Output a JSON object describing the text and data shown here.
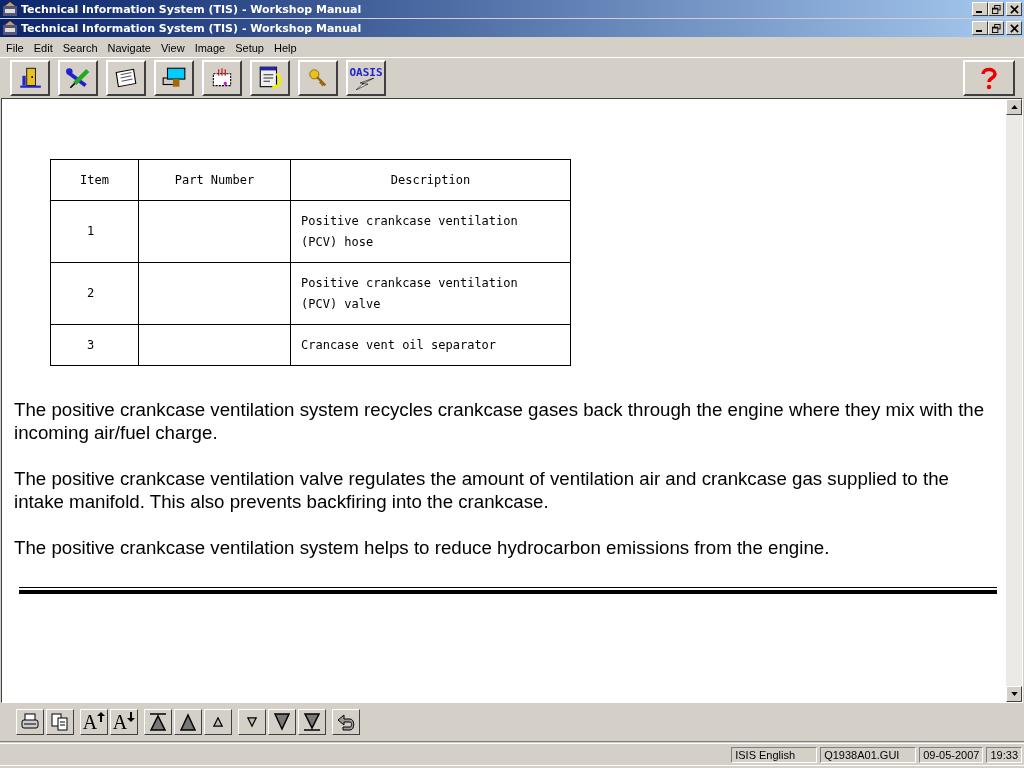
{
  "window_titles": [
    "Technical Information System (TIS) - Workshop Manual",
    "Technical Information System (TIS) - Workshop Manual"
  ],
  "menu": [
    "File",
    "Edit",
    "Search",
    "Navigate",
    "View",
    "Image",
    "Setup",
    "Help"
  ],
  "toolbar": [
    {
      "kind": "door"
    },
    {
      "kind": "tools"
    },
    {
      "kind": "papers"
    },
    {
      "kind": "monitor"
    },
    {
      "kind": "chip"
    },
    {
      "kind": "screen"
    },
    {
      "kind": "key"
    },
    {
      "kind": "logo",
      "label": "OASIS"
    }
  ],
  "table": {
    "columns": [
      "Item",
      "Part Number",
      "Description"
    ],
    "rows": [
      [
        "1",
        "",
        "Positive crankcase ventilation (PCV) hose"
      ],
      [
        "2",
        "",
        "Positive crankcase ventilation (PCV) valve"
      ],
      [
        "3",
        "",
        "Crancase vent oil separator"
      ]
    ]
  },
  "paragraphs": [
    "The positive crankcase ventilation system recycles crankcase gases back through the engine where they mix with the incoming air/fuel charge.",
    "The positive crankcase ventilation valve regulates the amount of ventilation air and crankcase gas supplied to the intake manifold. This also prevents backfiring into the crankcase.",
    "The positive crankcase ventilation system helps to reduce hydrocarbon emissions from the engine."
  ],
  "bottom_toolbar": [
    {
      "kind": "print"
    },
    {
      "kind": "copy"
    },
    {
      "kind": "font-up",
      "label": "A"
    },
    {
      "kind": "font-down",
      "label": "A"
    },
    {
      "kind": "first"
    },
    {
      "kind": "prev-section"
    },
    {
      "kind": "prev"
    },
    {
      "kind": "next"
    },
    {
      "kind": "next-section"
    },
    {
      "kind": "last"
    },
    {
      "kind": "back"
    }
  ],
  "status_bar": [
    "ISIS English",
    "Q1938A01.GUI",
    "09-05-2007",
    "19:33"
  ]
}
